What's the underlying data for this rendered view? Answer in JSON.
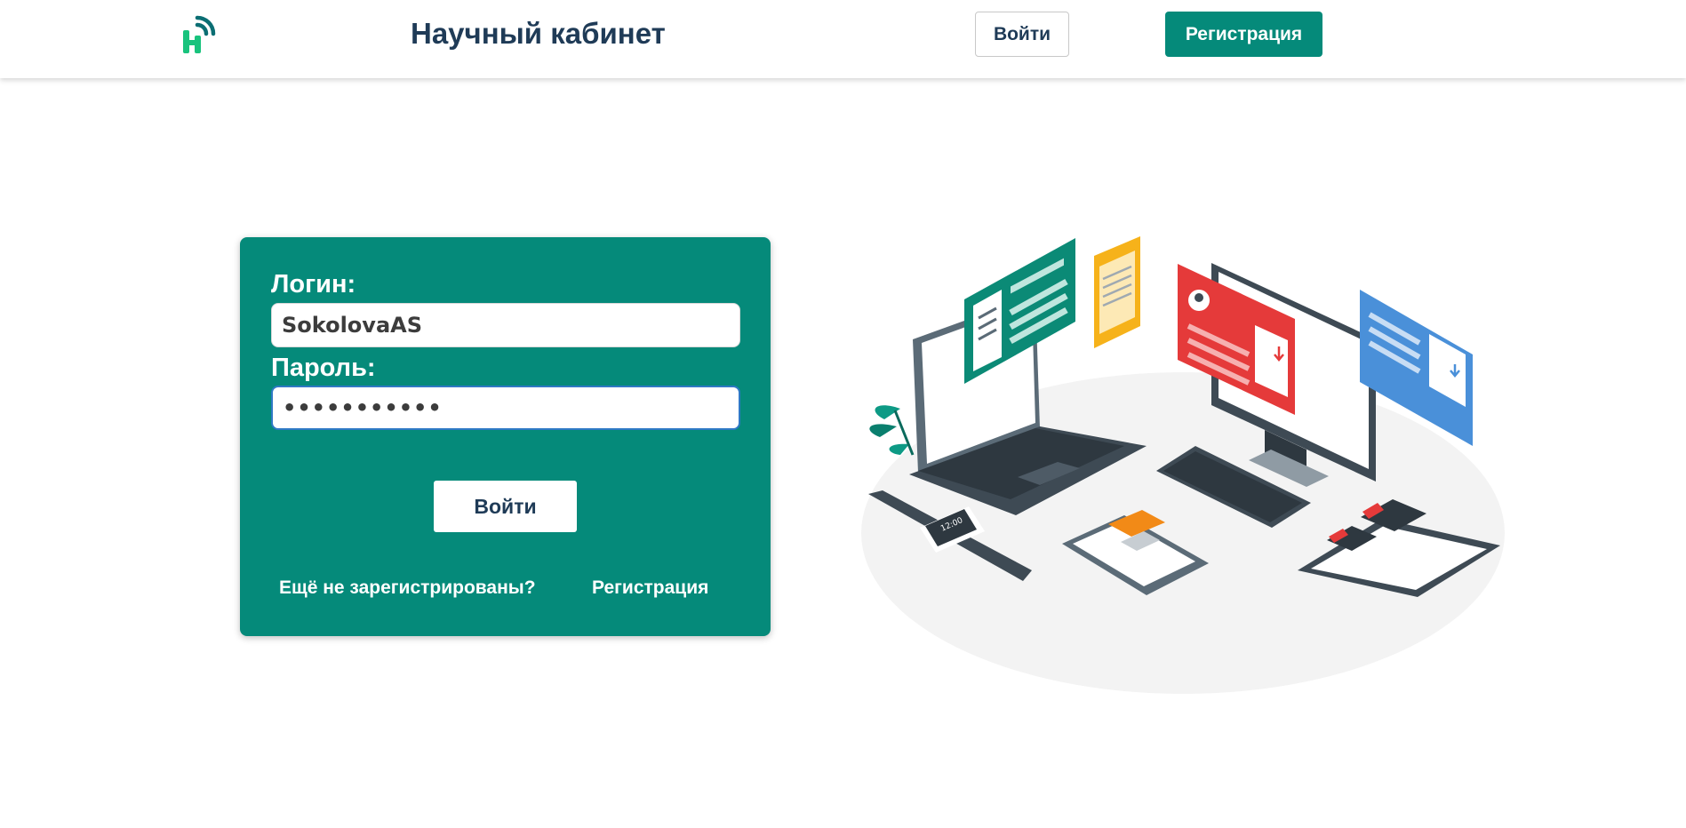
{
  "header": {
    "logo_icon": "hub-logo-icon",
    "title": "Научный кабинет",
    "login_label": "Войти",
    "register_label": "Регистрация"
  },
  "login_form": {
    "login_label": "Логин:",
    "login_value": "SokolovaAS",
    "password_label": "Пароль:",
    "password_value": "•••••••••••",
    "submit_label": "Войти",
    "not_registered_text": "Ещё не зарегистрированы?",
    "register_link": "Регистрация"
  },
  "illustration": {
    "icon": "devices-illustration",
    "watch_time": "12:00"
  },
  "colors": {
    "accent": "#058a7a",
    "title_text": "#1f3b57",
    "logo_green": "#19c37d",
    "logo_dark": "#0b6e73"
  }
}
